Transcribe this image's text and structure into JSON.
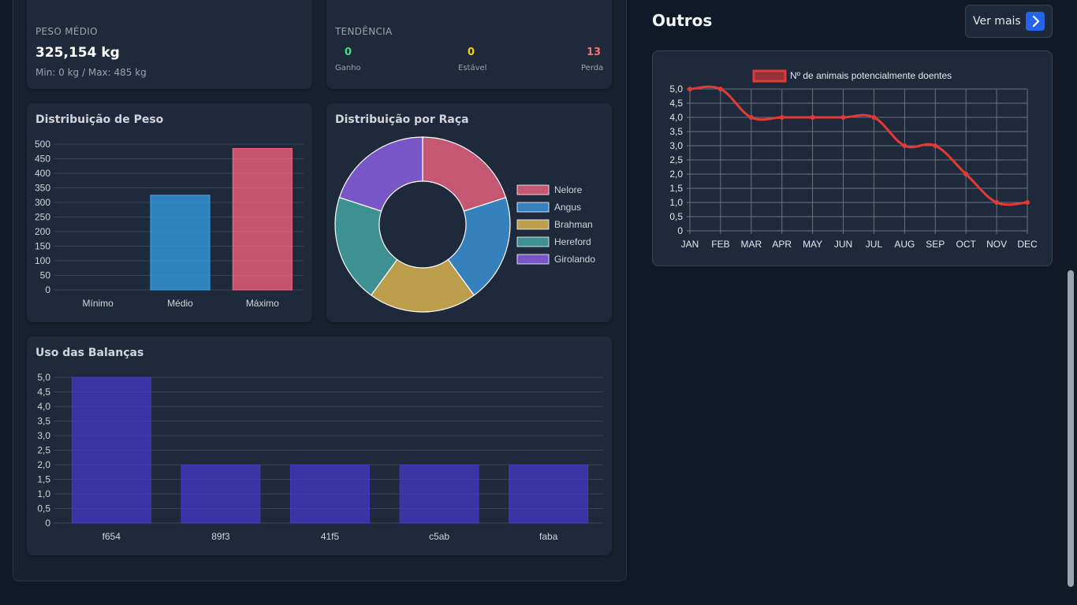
{
  "stats": {
    "peso_medio": {
      "label": "PESO MÉDIO",
      "value": "325,154 kg",
      "sub": "Min: 0 kg / Max: 485 kg"
    },
    "tendencia": {
      "label": "TENDÊNCIA",
      "items": [
        {
          "value": "0",
          "label": "Ganho",
          "color": "#4ade80"
        },
        {
          "value": "0",
          "label": "Estável",
          "color": "#facc15"
        },
        {
          "value": "13",
          "label": "Perda",
          "color": "#f87171"
        }
      ]
    }
  },
  "weight_card": {
    "title": "Distribuição de Peso"
  },
  "breed_card": {
    "title": "Distribuição por Raça"
  },
  "scales_card": {
    "title": "Uso das Balanças"
  },
  "outros": {
    "title": "Outros",
    "ver_mais_label": "Ver mais",
    "ver_mais_icon": "chevron-right-icon"
  },
  "chart_data": [
    {
      "type": "bar",
      "title": "Distribuição de Peso",
      "categories": [
        "Mínimo",
        "Médio",
        "Máximo"
      ],
      "values": [
        0,
        325,
        485
      ],
      "colors": [
        "#ff6384",
        "#36a2eb",
        "#ff6384"
      ],
      "ylim": [
        0,
        500
      ],
      "yticks": [
        "0",
        "50",
        "100",
        "150",
        "200",
        "250",
        "300",
        "350",
        "400",
        "450",
        "500"
      ],
      "grid": true
    },
    {
      "type": "pie",
      "title": "Distribuição por Raça",
      "labels": [
        "Nelore",
        "Angus",
        "Brahman",
        "Hereford",
        "Girolando"
      ],
      "values": [
        1,
        1,
        1,
        1,
        1
      ],
      "colors": [
        "#e2607e",
        "#3a91d6",
        "#d8b250",
        "#44a3a3",
        "#8a5ee0"
      ],
      "legend": "right"
    },
    {
      "type": "bar",
      "title": "Uso das Balanças",
      "categories": [
        "f654",
        "89f3",
        "41f5",
        "c5ab",
        "faba"
      ],
      "values": [
        5,
        2,
        2,
        2,
        2
      ],
      "color": "#4338ca",
      "ylim": [
        0,
        5
      ],
      "yticks": [
        "0",
        "0,5",
        "1,0",
        "1,5",
        "2,0",
        "2,5",
        "3,0",
        "3,5",
        "4,0",
        "4,5",
        "5,0"
      ],
      "grid": true
    },
    {
      "type": "line",
      "series": [
        {
          "name": "Nº de animais potencialmente doentes",
          "values": [
            5,
            5,
            4,
            4,
            4,
            4,
            4,
            3,
            3,
            2,
            1,
            1
          ],
          "color": "#e53935"
        }
      ],
      "categories": [
        "JAN",
        "FEB",
        "MAR",
        "APR",
        "MAY",
        "JUN",
        "JUL",
        "AUG",
        "SEP",
        "OCT",
        "NOV",
        "DEC"
      ],
      "ylim": [
        0,
        5
      ],
      "yticks": [
        "0",
        "0,5",
        "1,0",
        "1,5",
        "2,0",
        "2,5",
        "3,0",
        "3,5",
        "4,0",
        "4,5",
        "5,0"
      ],
      "grid": true,
      "legend": "top"
    }
  ]
}
